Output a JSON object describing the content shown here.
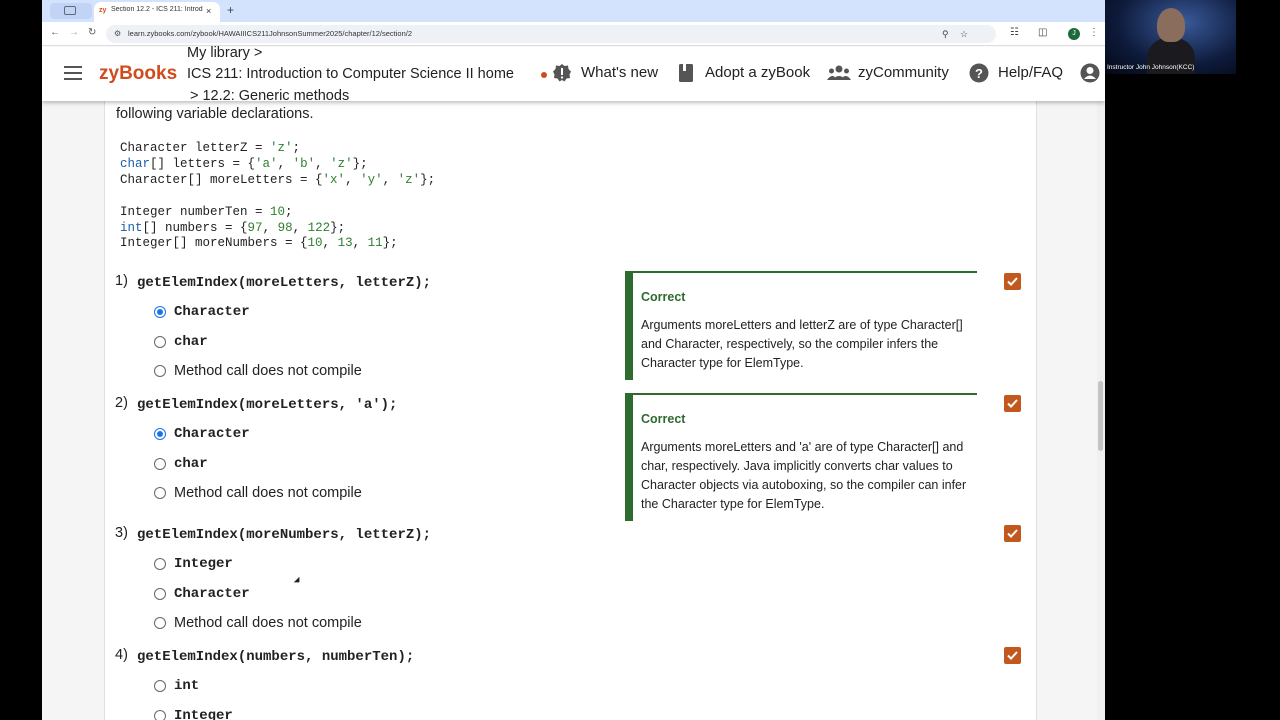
{
  "browser": {
    "tab_title": "Section 12.2 - ICS 211: Introd",
    "tab_favicon": "zy",
    "tab_close": "×",
    "new_tab": "+",
    "url": "learn.zybooks.com/zybook/HAWAIIICS211JohnsonSummer2025/chapter/12/section/2",
    "profile_initial": "J"
  },
  "header": {
    "logo": "zyBooks",
    "breadcrumb_1": "My library >",
    "breadcrumb_2": "ICS 211: Introduction to Computer Science II home",
    "breadcrumb_3": "> 12.2: Generic methods",
    "whats_new": "What's new",
    "adopt": "Adopt a zyBook",
    "community": "zyCommunity",
    "help": "Help/FAQ"
  },
  "content": {
    "intro": "following variable declarations.",
    "code_lines": [
      "Character letterZ = 'z';",
      "char[] letters = {'a', 'b', 'z'};",
      "Character[] moreLetters = {'x', 'y', 'z'};",
      "",
      "Integer numberTen = 10;",
      "int[] numbers = {97, 98, 122};",
      "Integer[] moreNumbers = {10, 13, 11};"
    ],
    "questions": [
      {
        "num": "1)",
        "code": "getElemIndex(moreLetters, letterZ);",
        "options": [
          "Character",
          "char",
          "Method call does not compile"
        ],
        "selected": 0,
        "feedback_title": "Correct",
        "feedback": "Arguments moreLetters and letterZ are of type Character[] and Character, respectively, so the compiler infers the Character type for ElemType."
      },
      {
        "num": "2)",
        "code": "getElemIndex(moreLetters, 'a');",
        "options": [
          "Character",
          "char",
          "Method call does not compile"
        ],
        "selected": 0,
        "feedback_title": "Correct",
        "feedback": "Arguments moreLetters and 'a' are of type Character[] and char, respectively. Java implicitly converts char values to Character objects via autoboxing, so the compiler can infer the Character type for ElemType."
      },
      {
        "num": "3)",
        "code": "getElemIndex(moreNumbers, letterZ);",
        "options": [
          "Integer",
          "Character",
          "Method call does not compile"
        ],
        "selected": -1
      },
      {
        "num": "4)",
        "code": "getElemIndex(numbers, numberTen);",
        "options": [
          "int",
          "Integer"
        ],
        "selected": -1
      }
    ]
  },
  "webcam": {
    "label": "Instructor John Johnson(KCC)"
  },
  "colors": {
    "brand": "#d24b1c",
    "correct_green": "#2e6b2e",
    "check_orange": "#c3581f",
    "radio_blue": "#1a73e8"
  }
}
